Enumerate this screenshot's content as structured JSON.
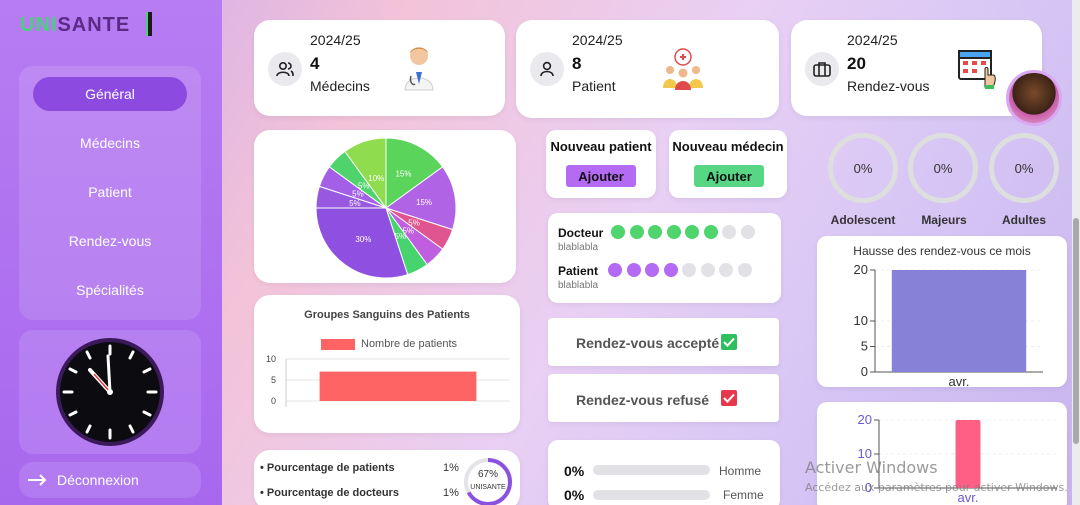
{
  "app": {
    "logo_part1": "UNI",
    "logo_part2": "SANTE",
    "brand_green": "#4ad07a",
    "brand_purple": "#a868ee"
  },
  "sidebar": {
    "items": [
      {
        "label": "Général",
        "active": true
      },
      {
        "label": "Médecins",
        "active": false
      },
      {
        "label": "Patient",
        "active": false
      },
      {
        "label": "Rendez-vous",
        "active": false
      },
      {
        "label": "Spécialités",
        "active": false
      }
    ],
    "logout_label": "Déconnexion",
    "logout_icon": "arrow-right-icon"
  },
  "stats": [
    {
      "date": "2024/25",
      "value": "4",
      "label": "Médecins",
      "icon": "users-icon"
    },
    {
      "date": "2024/25",
      "value": "8",
      "label": "Patient",
      "icon": "user-icon"
    },
    {
      "date": "2024/25",
      "value": "20",
      "label": "Rendez-vous",
      "icon": "briefcase-icon"
    }
  ],
  "pie": {
    "chart_data": {
      "type": "pie",
      "values": [
        15,
        15,
        5,
        5,
        5,
        30,
        5,
        5,
        5,
        10
      ],
      "labels": [
        "15%",
        "15%",
        "5%",
        "5%",
        "5%",
        "30%",
        "5%",
        "5%",
        "5%",
        "10%"
      ],
      "colors": [
        "#5ad45a",
        "#b163e6",
        "#e0558f",
        "#c05ee0",
        "#47d36e",
        "#8f4fe0",
        "#9958e0",
        "#a35fe6",
        "#4ed46a",
        "#8fdd4f"
      ]
    }
  },
  "blood": {
    "title": "Groupes Sanguins des Patients",
    "legend": "Nombre de patients",
    "bar_color": "#ff6464",
    "chart_data": {
      "type": "bar",
      "categories": [
        ""
      ],
      "values": [
        7
      ],
      "ylim": [
        0,
        10
      ],
      "yticks": [
        "10",
        "5",
        "0"
      ]
    }
  },
  "percent_card": {
    "rows": [
      {
        "label": "Pourcentage de patients",
        "value": "1%"
      },
      {
        "label": "Pourcentage de docteurs",
        "value": "1%"
      }
    ],
    "ring_value": "67%",
    "ring_label": "UNISANTE",
    "ring_fraction": 0.67
  },
  "new_patient": {
    "title": "Nouveau patient",
    "button": "Ajouter"
  },
  "new_doctor": {
    "title": "Nouveau médecin",
    "button": "Ajouter"
  },
  "dots_card": {
    "rows": [
      {
        "label": "Docteur",
        "sub": "blablabla",
        "filled": 6,
        "total": 8,
        "color": "#4fd46e"
      },
      {
        "label": "Patient",
        "sub": "blablabla",
        "filled": 4,
        "total": 8,
        "color": "#b46af2"
      }
    ]
  },
  "rdv": {
    "accepted": "Rendez-vous accepté",
    "refused": "Rendez-vous refusé",
    "accepted_icon": "check-icon",
    "refused_icon": "check-icon"
  },
  "gender": {
    "rows": [
      {
        "pct": "0%",
        "label": "Homme"
      },
      {
        "pct": "0%",
        "label": "Femme"
      }
    ]
  },
  "age_rings": [
    {
      "value": "0%",
      "label": "Adolescent"
    },
    {
      "value": "0%",
      "label": "Majeurs"
    },
    {
      "value": "0%",
      "label": "Adultes"
    }
  ],
  "rdv_chart": {
    "title": "Hausse des rendez-vous ce mois",
    "bar_color": "#8781d8",
    "chart_data": {
      "type": "bar",
      "categories": [
        "avr."
      ],
      "values": [
        20
      ],
      "ylim": [
        0,
        20
      ],
      "yticks": [
        "20",
        "10",
        "5",
        "0"
      ]
    }
  },
  "rdv_chart2": {
    "bar_color": "#ff5f85",
    "chart_data": {
      "type": "bar",
      "categories": [
        "avr."
      ],
      "values": [
        20
      ],
      "ylim": [
        0,
        20
      ],
      "yticks": [
        "20",
        "10",
        "0"
      ]
    }
  },
  "watermark": {
    "title": "Activer Windows",
    "subtitle": "Accédez aux paramètres pour activer Windows."
  }
}
